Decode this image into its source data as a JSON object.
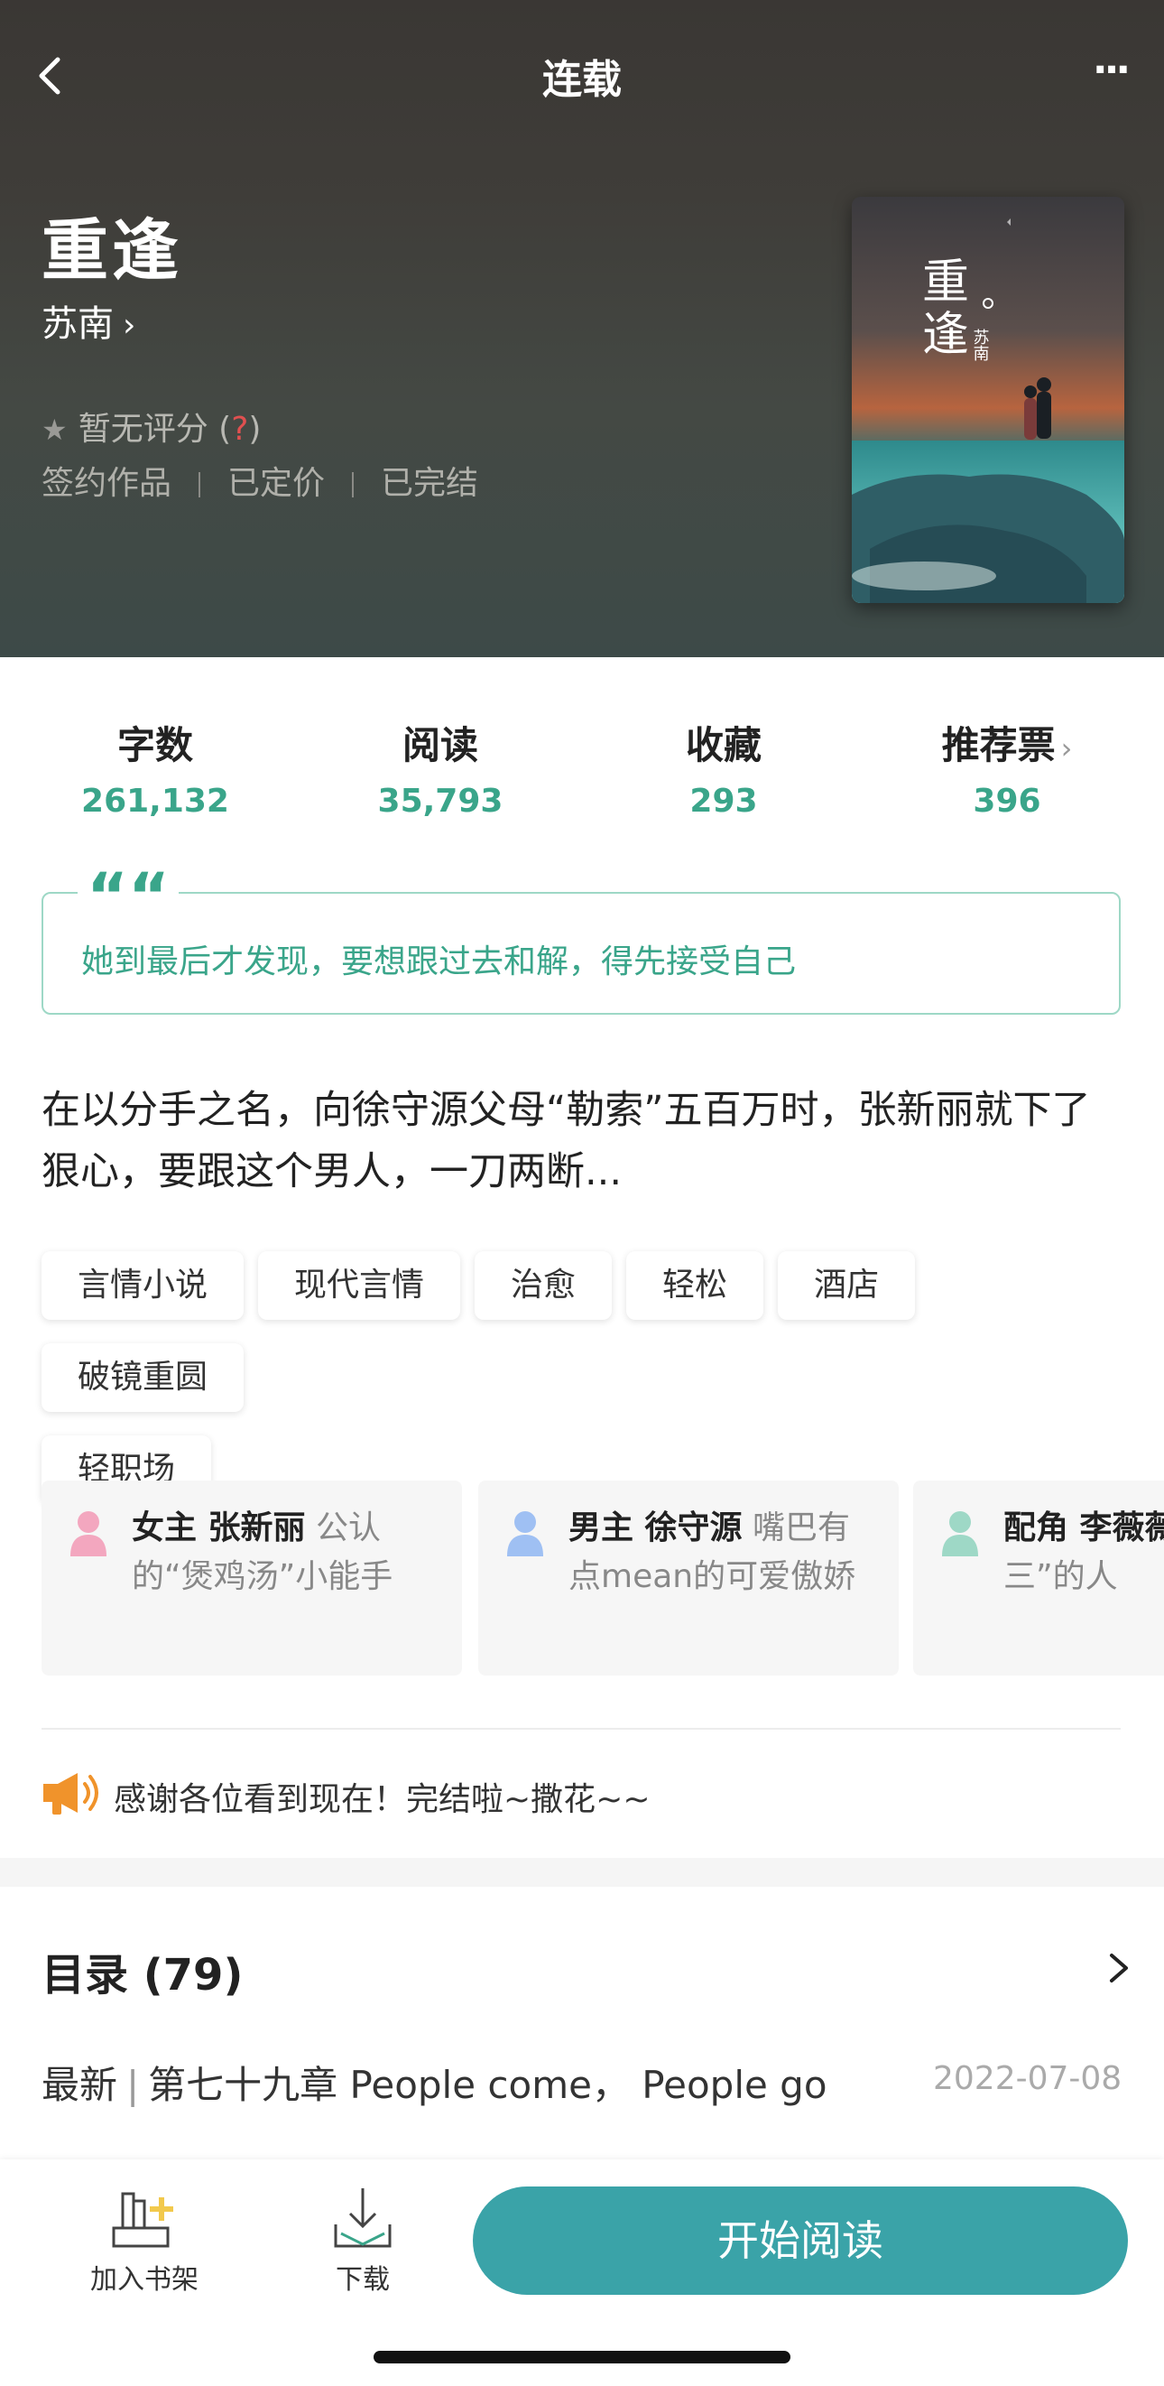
{
  "header": {
    "title": "连载",
    "more_label": "···"
  },
  "book": {
    "title": "重逢",
    "author": "苏南",
    "rating_text": "暂无评分",
    "rating_help": "?",
    "meta": [
      "签约作品",
      "已定价",
      "已完结"
    ],
    "cover_title_chars": [
      "重",
      "逢"
    ],
    "cover_author": "苏南"
  },
  "stats": [
    {
      "label": "字数",
      "value": "261,132"
    },
    {
      "label": "阅读",
      "value": "35,793"
    },
    {
      "label": "收藏",
      "value": "293"
    },
    {
      "label": "推荐票",
      "value": "396"
    }
  ],
  "quote": {
    "mark": "“",
    "text": "她到最后才发现，要想跟过去和解，得先接受自己"
  },
  "description": "在以分手之名，向徐守源父母“勒索”五百万时，张新丽就下了狠心，要跟这个男人，一刀两断...",
  "tags": [
    "言情小说",
    "现代言情",
    "治愈",
    "轻松",
    "酒店",
    "破镜重圆",
    "轻职场"
  ],
  "characters": [
    {
      "role": "女主 张新丽",
      "desc": "公认的“煲鸡汤”小能手",
      "color": "#f3a7bf"
    },
    {
      "role": "男主 徐守源",
      "desc": "嘴巴有点mean的可爱傲娇",
      "color": "#9fc0f3"
    },
    {
      "role": "配角 李薇薇",
      "desc": "当“小三”的人",
      "color": "#9ed8c6"
    }
  ],
  "notice": "感谢各位看到现在！完结啦~撒花~~",
  "catalog": {
    "title": "目录 (79)",
    "latest_label": "最新",
    "latest_chapter": "第七十九章  People come， People go",
    "latest_date": "2022-07-08"
  },
  "bottom": {
    "shelf": "加入书架",
    "download": "下载",
    "read": "开始阅读"
  },
  "colors": {
    "accent": "#3aa58a",
    "button": "#3aa3a8"
  }
}
